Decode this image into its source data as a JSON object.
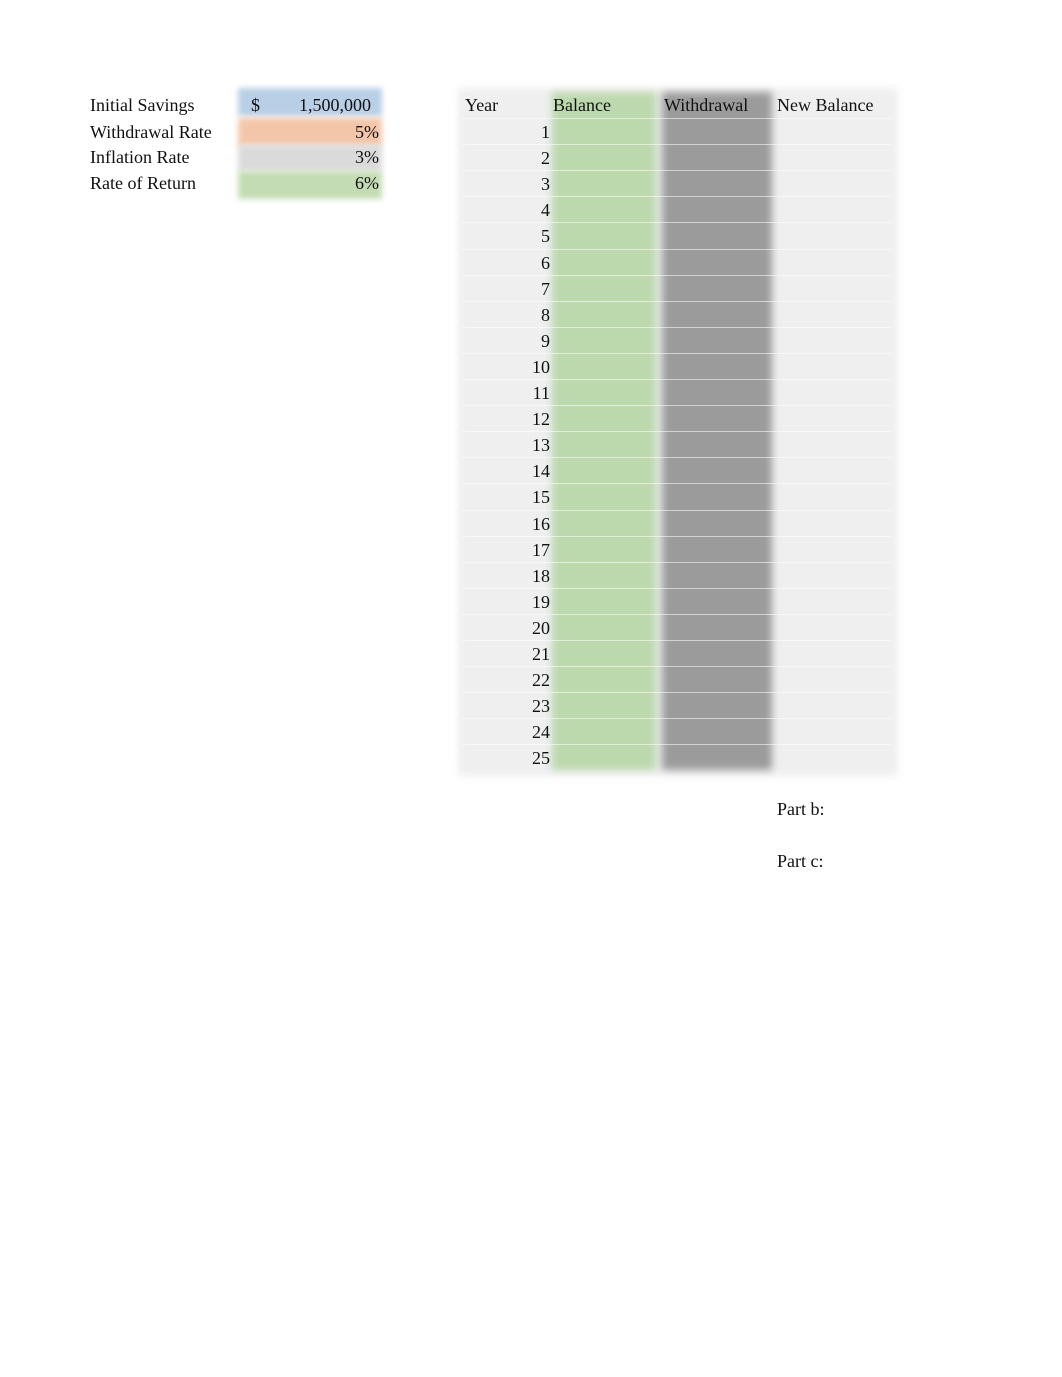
{
  "inputs": [
    {
      "label": "Initial Savings",
      "currency": "$",
      "value": "1,500,000",
      "color": "#b8cfe6"
    },
    {
      "label": "Withdrawal Rate",
      "currency": "",
      "value": "5%",
      "color": "#f3c6a9"
    },
    {
      "label": "Inflation Rate",
      "currency": "",
      "value": "3%",
      "color": "#dadada"
    },
    {
      "label": "Rate of Return",
      "currency": "",
      "value": "6%",
      "color": "#c4dcb3"
    }
  ],
  "table": {
    "headers": {
      "year": "Year",
      "balance": "Balance",
      "withdrawal": "Withdrawal",
      "new_balance": "New Balance"
    },
    "years": [
      "1",
      "2",
      "3",
      "4",
      "5",
      "6",
      "7",
      "8",
      "9",
      "10",
      "11",
      "12",
      "13",
      "14",
      "15",
      "16",
      "17",
      "18",
      "19",
      "20",
      "21",
      "22",
      "23",
      "24",
      "25"
    ],
    "colors": {
      "balance": "#bcd8ad",
      "withdrawal": "#9b9b9b",
      "background": "#efefef"
    }
  },
  "parts": {
    "b": "Part b:",
    "c": "Part c:"
  }
}
